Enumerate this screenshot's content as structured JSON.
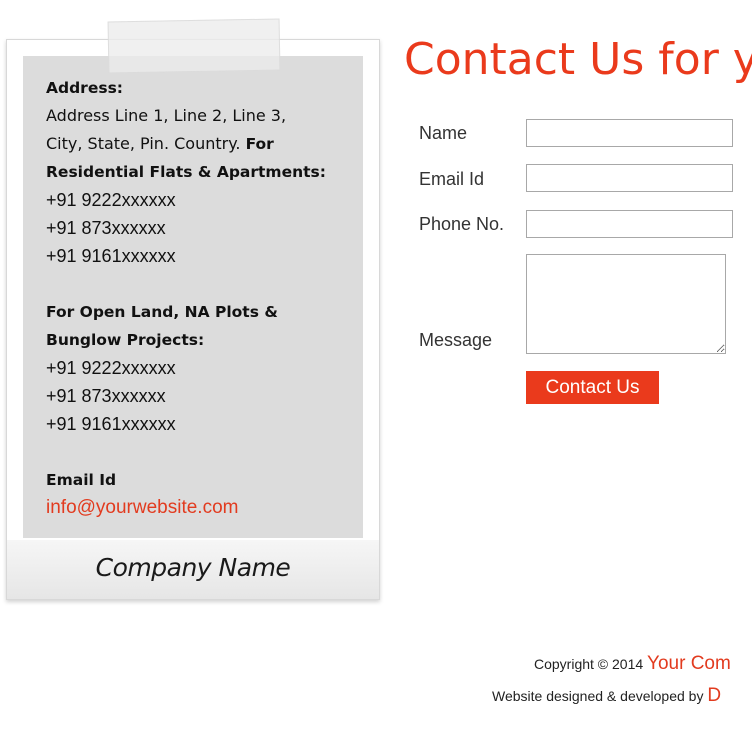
{
  "address_card": {
    "address_label": "Address:",
    "address_line1": "Address Line 1, Line 2, Line 3,",
    "address_line2": "City, State, Pin. Country.",
    "residential_label_part1": "For",
    "residential_label_part2": "Residential Flats & Apartments:",
    "residential_phones": [
      "+91 9222xxxxxx",
      "+91 873xxxxxx",
      "+91 9161xxxxxx"
    ],
    "land_label_line1": "For Open Land, NA Plots &",
    "land_label_line2": "Bunglow Projects:",
    "land_phones": [
      "+91 9222xxxxxx",
      "+91 873xxxxxx",
      "+91 9161xxxxxx"
    ],
    "email_label": "Email Id",
    "email_value": "info@yourwebsite.com",
    "company_name": "Company Name"
  },
  "form": {
    "title": "Contact Us for y",
    "name_label": "Name",
    "email_label": "Email Id",
    "phone_label": "Phone No.",
    "message_label": "Message",
    "name_value": "",
    "email_value": "",
    "phone_value": "",
    "message_value": "",
    "submit_label": "Contact Us"
  },
  "footer": {
    "copyright_prefix": "Copyright © 2014",
    "company_link": "Your Com",
    "designed_by_prefix": "Website designed & developed by",
    "designer_link": "D"
  },
  "colors": {
    "accent": "#ea3a1c",
    "card_inner_bg": "#dcdcdc"
  }
}
